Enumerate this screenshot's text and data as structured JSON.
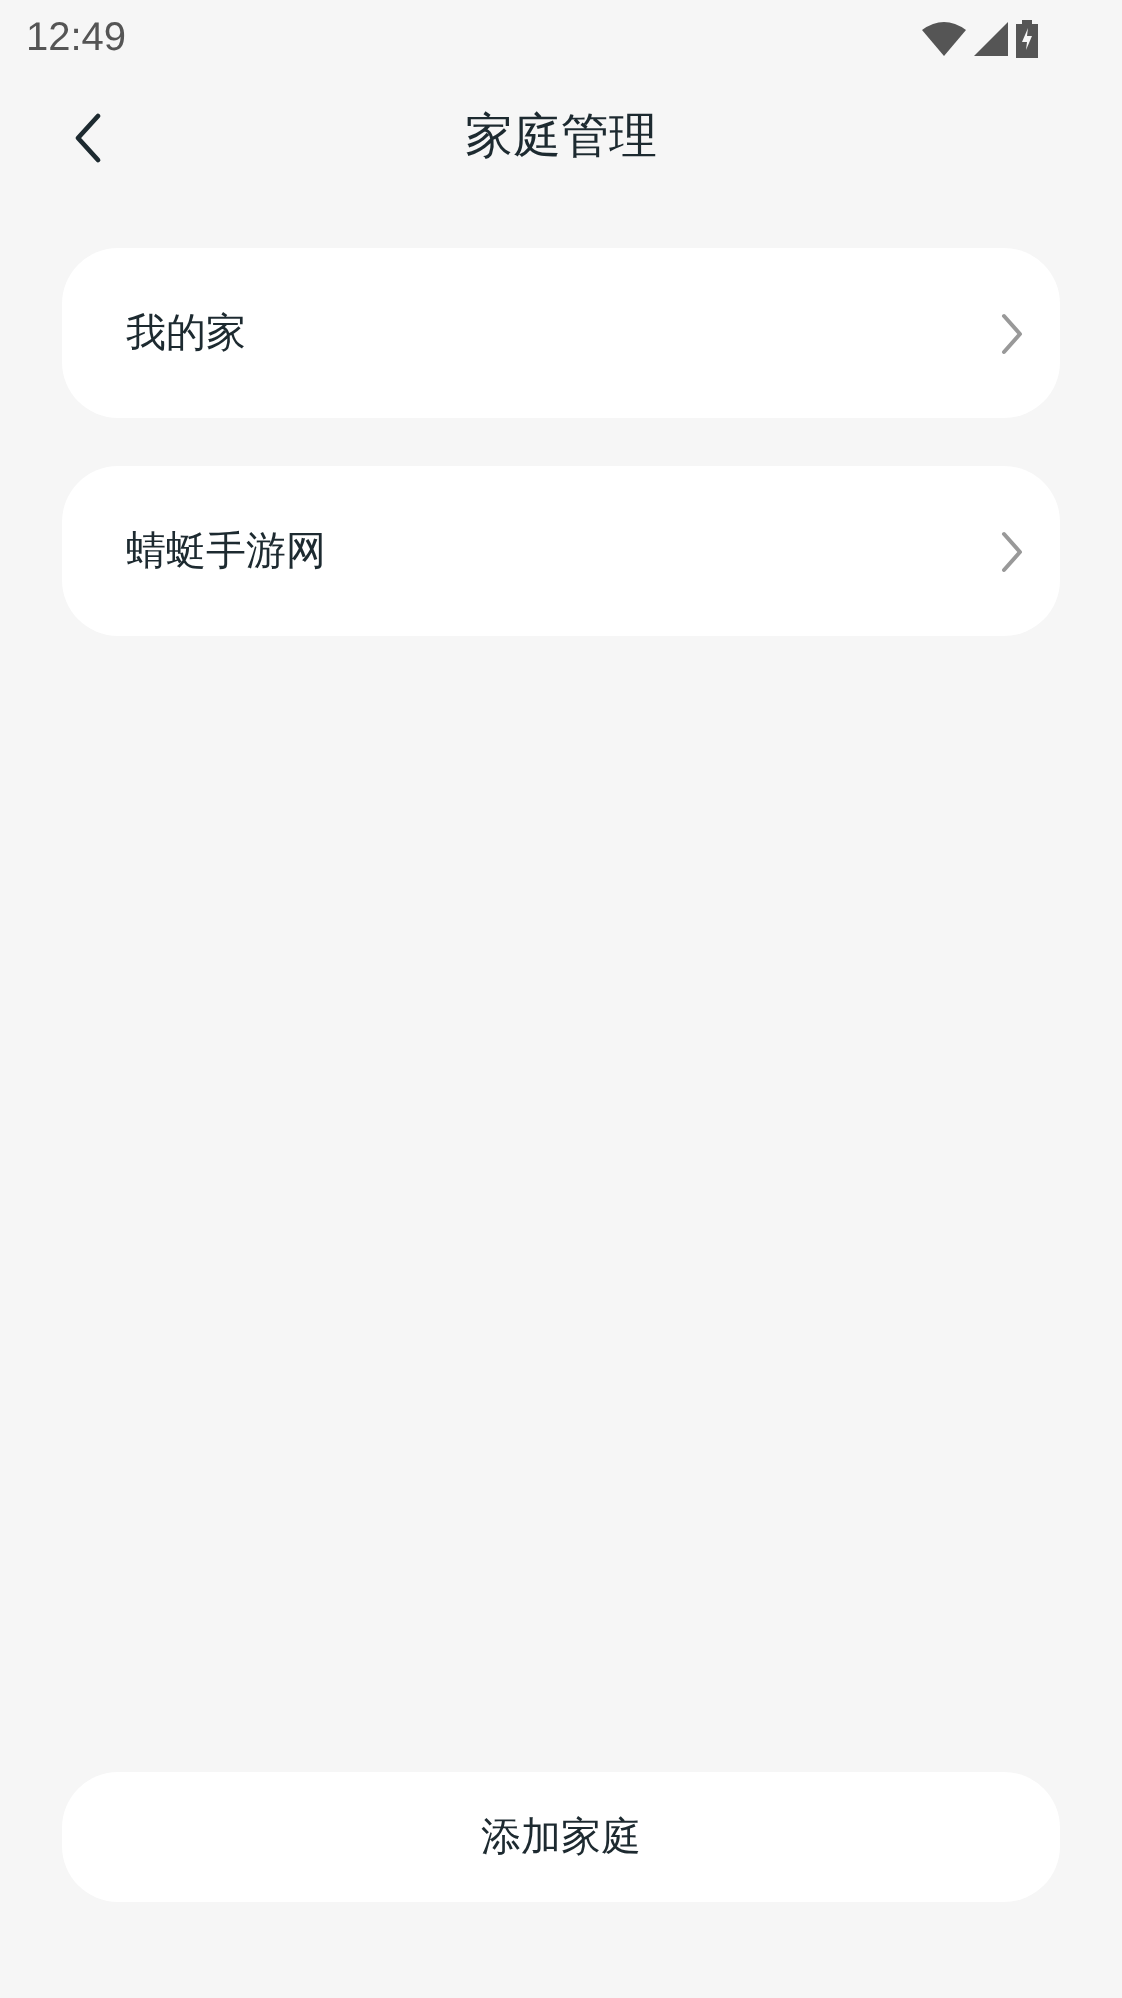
{
  "status_bar": {
    "time": "12:49"
  },
  "header": {
    "title": "家庭管理"
  },
  "homes": [
    {
      "name": "我的家"
    },
    {
      "name": "蜻蜓手游网"
    }
  ],
  "add_button": {
    "label": "添加家庭"
  }
}
